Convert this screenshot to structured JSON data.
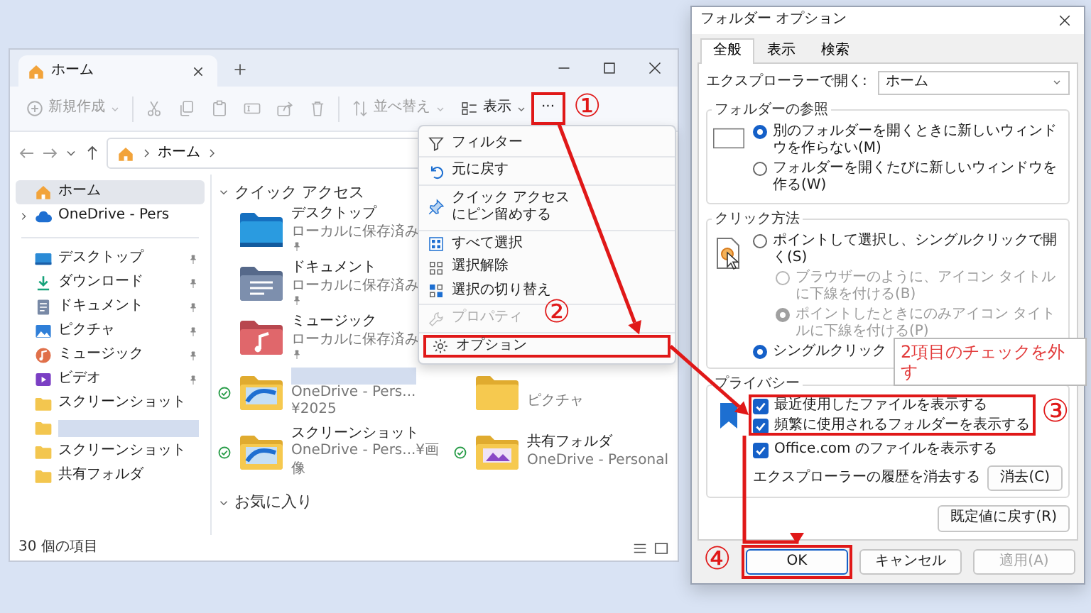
{
  "explorer": {
    "tab": {
      "title": "ホーム"
    },
    "toolbar": [
      {
        "kind": "new",
        "label": "新規作成",
        "disabled": true,
        "dropdown": true
      },
      {
        "kind": "cut",
        "disabled": true
      },
      {
        "kind": "copy",
        "disabled": true
      },
      {
        "kind": "paste",
        "disabled": true
      },
      {
        "kind": "rename",
        "disabled": true
      },
      {
        "kind": "share",
        "disabled": true
      },
      {
        "kind": "delete",
        "disabled": true
      },
      {
        "kind": "sort",
        "label": "並べ替え",
        "disabled": true,
        "dropdown": true
      },
      {
        "kind": "view",
        "label": "表示",
        "disabled": false,
        "dropdown": true
      },
      {
        "kind": "more",
        "label": "···",
        "disabled": false,
        "dropdown": false
      }
    ],
    "address": {
      "crumbs": [
        "ホーム"
      ]
    },
    "sidebar": {
      "groups": [
        [
          {
            "kind": "home",
            "label": "ホーム",
            "selected": true,
            "expandable": false
          },
          {
            "kind": "cloud",
            "label": "OneDrive - Pers",
            "selected": false,
            "expandable": true
          }
        ],
        [
          {
            "kind": "desktop",
            "label": "デスクトップ",
            "selected": false,
            "pinned": true
          },
          {
            "kind": "download",
            "label": "ダウンロード",
            "selected": false,
            "pinned": true
          },
          {
            "kind": "documents",
            "label": "ドキュメント",
            "selected": false,
            "pinned": true
          },
          {
            "kind": "pictures",
            "label": "ピクチャ",
            "selected": false,
            "pinned": true
          },
          {
            "kind": "music",
            "label": "ミュージック",
            "selected": false,
            "pinned": true
          },
          {
            "kind": "video",
            "label": "ビデオ",
            "selected": false,
            "pinned": true
          },
          {
            "kind": "folder",
            "label": "スクリーンショット",
            "selected": false,
            "pinned": false
          },
          {
            "kind": "folder",
            "redacted": true,
            "selected": false,
            "pinned": false
          },
          {
            "kind": "folder",
            "label": "スクリーンショット",
            "selected": false,
            "pinned": false
          },
          {
            "kind": "folder",
            "label": "共有フォルダ",
            "selected": false,
            "pinned": false
          }
        ]
      ]
    },
    "quick_access": {
      "title": "クイック アクセス",
      "rows": [
        [
          {
            "kind": "desktop",
            "name": "デスクトップ",
            "sub": "ローカルに保存済み",
            "pinned": true,
            "synced": false
          }
        ],
        [
          {
            "kind": "documents",
            "name": "ドキュメント",
            "sub": "ローカルに保存済み",
            "pinned": true,
            "synced": false
          }
        ],
        [
          {
            "kind": "music",
            "name": "ミュージック",
            "sub": "ローカルに保存済み",
            "pinned": true,
            "synced": false
          }
        ],
        [
          {
            "kind": "onedrive",
            "redacted": true,
            "sub": "OneDrive - Pers...¥2025",
            "pinned": false,
            "synced": true
          },
          {
            "kind": "pictures",
            "sub": "ピクチャ",
            "pinned": false,
            "synced": false
          }
        ],
        [
          {
            "kind": "onedrive",
            "name": "スクリーンショット",
            "sub": "OneDrive - Pers...¥画像",
            "pinned": false,
            "synced": true
          },
          {
            "kind": "shared",
            "name": "共有フォルダ",
            "sub": "OneDrive - Personal",
            "pinned": false,
            "synced": true
          }
        ]
      ]
    },
    "favorites": {
      "title": "お気に入り"
    },
    "status": "30 個の項目"
  },
  "menu": {
    "groups": [
      [
        {
          "kind": "filter",
          "label": "フィルター",
          "disabled": false
        }
      ],
      [
        {
          "kind": "undo",
          "label": "元に戻す",
          "disabled": false
        }
      ],
      [
        {
          "kind": "pin",
          "label": "クイック アクセスにピン留めする",
          "disabled": false
        }
      ],
      [
        {
          "kind": "select_all",
          "label": "すべて選択",
          "disabled": false
        },
        {
          "kind": "select_none",
          "label": "選択解除",
          "disabled": false
        },
        {
          "kind": "invert",
          "label": "選択の切り替え",
          "disabled": false
        }
      ],
      [
        {
          "kind": "properties",
          "label": "プロパティ",
          "disabled": true
        }
      ],
      [
        {
          "kind": "options",
          "label": "オプション",
          "disabled": false
        }
      ]
    ]
  },
  "dialog": {
    "title": "フォルダー オプション",
    "tabs": [
      {
        "label": "全般",
        "selected": true
      },
      {
        "label": "表示",
        "selected": false
      },
      {
        "label": "検索",
        "selected": false
      }
    ],
    "open_in": {
      "label": "エクスプローラーで開く:",
      "value": "ホーム"
    },
    "browse": {
      "title": "フォルダーの参照",
      "options": [
        {
          "label": "別のフォルダーを開くときに新しいウィンドウを作らない(M)",
          "selected": true,
          "disabled": false
        },
        {
          "label": "フォルダーを開くたびに新しいウィンドウを作る(W)",
          "selected": false,
          "disabled": false
        }
      ]
    },
    "click": {
      "title": "クリック方法",
      "options": [
        {
          "label": "ポイントして選択し、シングルクリックで開く(S)",
          "selected": false,
          "disabled": false,
          "children": [
            {
              "label": "ブラウザーのように、アイコン タイトルに下線を付ける(B)",
              "selected": false,
              "disabled": true
            },
            {
              "label": "ポイントしたときにのみアイコン タイトルに下線を付ける(P)",
              "selected": true,
              "disabled": true
            }
          ]
        },
        {
          "label": "シングルクリック",
          "selected": true,
          "disabled": false
        }
      ]
    },
    "privacy": {
      "title": "プライバシー",
      "options": [
        {
          "label": "最近使用したファイルを表示する",
          "checked": true
        },
        {
          "label": "頻繁に使用されるフォルダーを表示する",
          "checked": true
        },
        {
          "label": "Office.com のファイルを表示する",
          "checked": true
        }
      ],
      "clear_label": "エクスプローラーの履歴を消去する",
      "clear_button": "消去(C)"
    },
    "reset_button": "既定値に戻す(R)",
    "buttons": [
      {
        "label": "OK",
        "disabled": false,
        "default": true
      },
      {
        "label": "キャンセル",
        "disabled": false,
        "default": false
      },
      {
        "label": "適用(A)",
        "disabled": true,
        "default": false
      }
    ]
  },
  "annotations": {
    "steps": [
      "①",
      "②",
      "③",
      "④"
    ],
    "callout": "2項目のチェックを外す"
  }
}
